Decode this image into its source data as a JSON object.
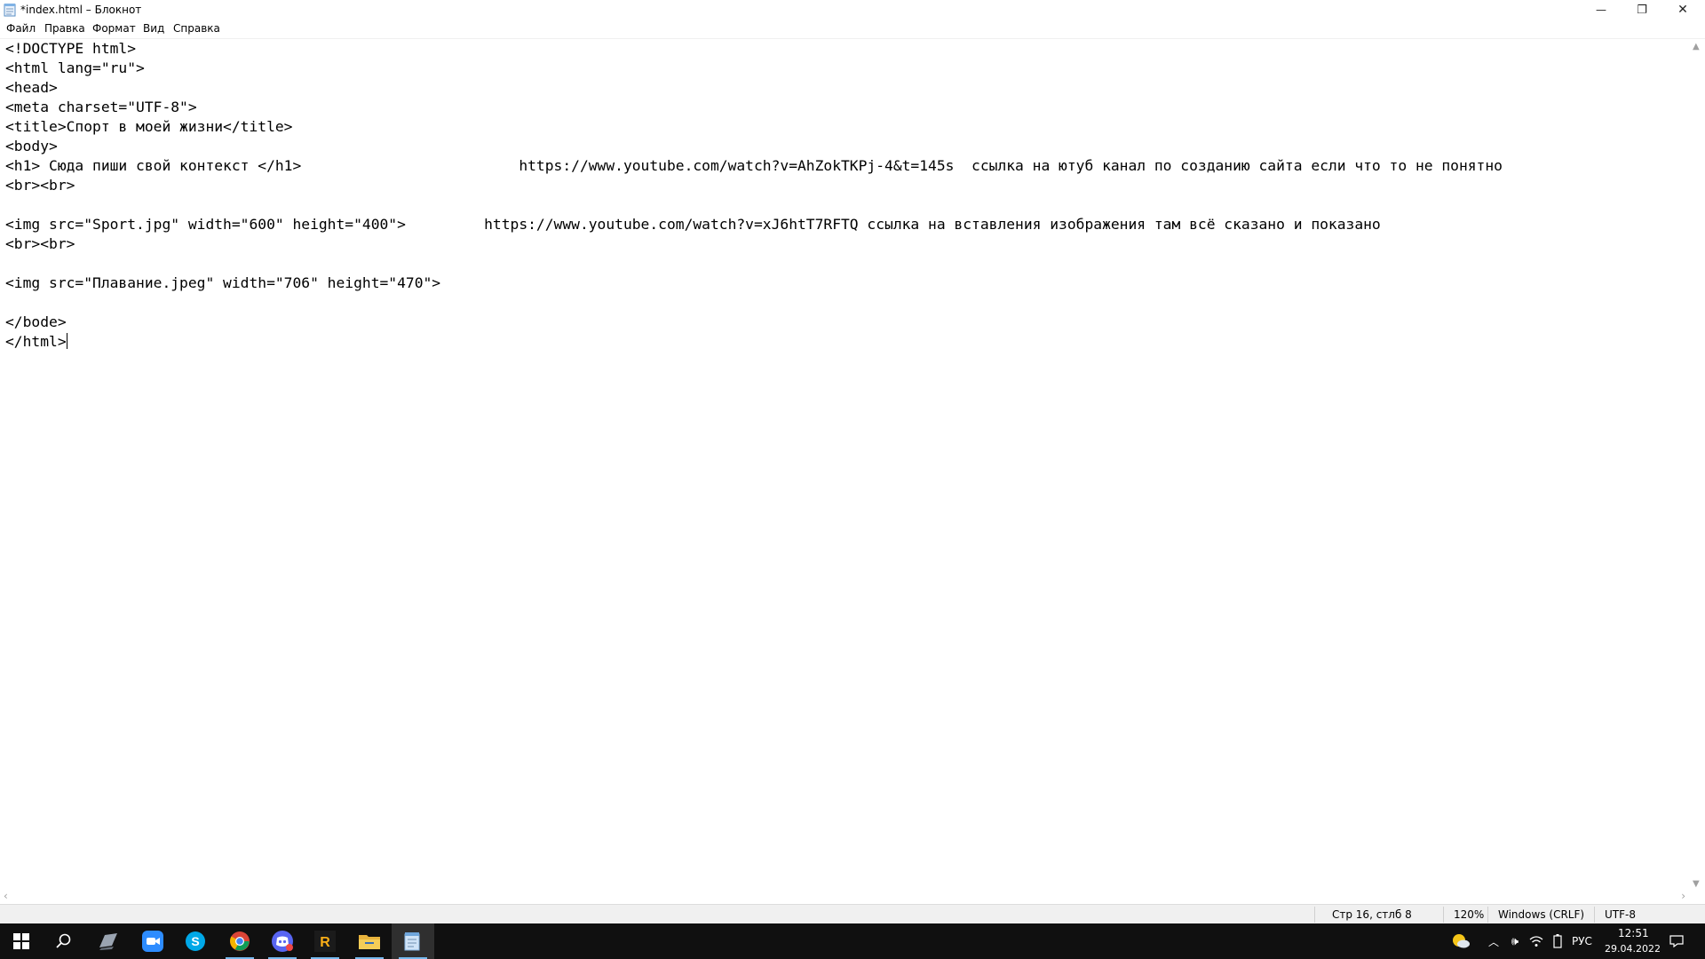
{
  "window": {
    "title": "*index.html – Блокнот",
    "controls": {
      "minimize": "—",
      "maximize": "❐",
      "close": "✕"
    }
  },
  "menu": {
    "items": [
      "Файл",
      "Правка",
      "Формат",
      "Вид",
      "Справка"
    ]
  },
  "editor": {
    "lines": [
      "<!DOCTYPE html>",
      "<html lang=\"ru\">",
      "<head>",
      "<meta charset=\"UTF-8\">",
      "<title>Спорт в моей жизни</title>",
      "<body>",
      "<h1> Сюда пиши свой контекст </h1>                         https://www.youtube.com/watch?v=AhZokTKPj-4&t=145s  ссылка на ютуб канал по созданию сайта если что то не понятно",
      "<br><br>",
      "",
      "<img src=\"Sport.jpg\" width=\"600\" height=\"400\">         https://www.youtube.com/watch?v=xJ6htT7RFTQ ссылка на вставления изображения там всё сказано и показано",
      "<br><br>",
      "",
      "<img src=\"Плавание.jpeg\" width=\"706\" height=\"470\">",
      "",
      "</bode>",
      "</html>"
    ]
  },
  "status": {
    "position": "Стр 16, стлб 8",
    "zoom": "120%",
    "line_ending": "Windows (CRLF)",
    "encoding": "UTF-8"
  },
  "taskbar": {
    "apps": [
      "start-icon",
      "search-icon",
      "vpn-icon",
      "zoom-icon",
      "skype-icon",
      "chrome-icon",
      "discord-icon",
      "rockstar-icon",
      "file-explorer-icon",
      "notepad-icon"
    ],
    "tray": {
      "language": "РУС",
      "time": "12:51",
      "date": "29.04.2022"
    }
  },
  "colors": {
    "taskbar_bg": "#101010",
    "active_underline": "#76b9ed",
    "statusbar_bg": "#f0f0f0"
  }
}
